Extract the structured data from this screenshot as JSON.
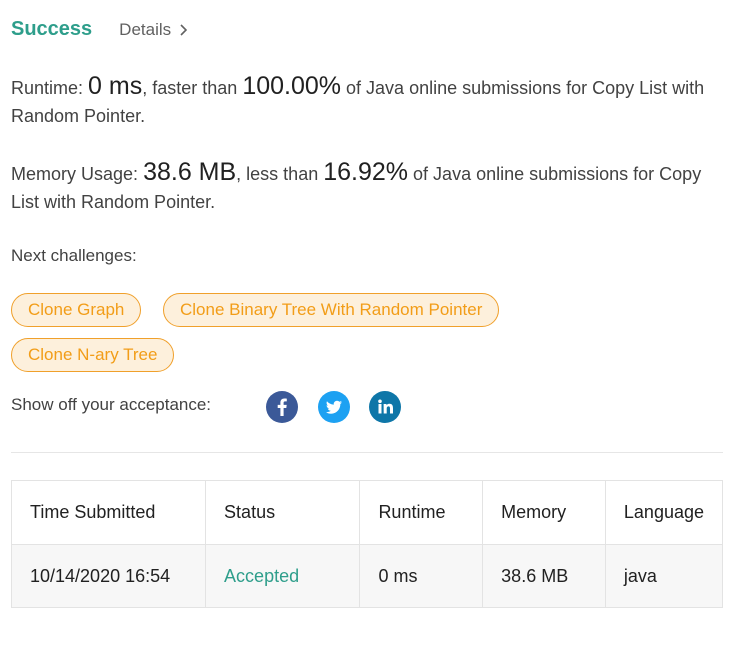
{
  "header": {
    "status": "Success",
    "details_label": "Details"
  },
  "runtime": {
    "label": "Runtime:",
    "value": "0 ms",
    "mid": ", faster than",
    "percent": "100.00%",
    "suffix": "of Java online submissions for Copy List with Random Pointer."
  },
  "memory": {
    "label": "Memory Usage:",
    "value": "38.6 MB",
    "mid": ", less than",
    "percent": "16.92%",
    "suffix": "of Java online submissions for Copy List with Random Pointer."
  },
  "next_challenges": {
    "label": "Next challenges:",
    "items": [
      "Clone Graph",
      "Clone Binary Tree With Random Pointer",
      "Clone N-ary Tree"
    ]
  },
  "share": {
    "label": "Show off your acceptance:",
    "icons": [
      "facebook-icon",
      "twitter-icon",
      "linkedin-icon"
    ],
    "colors": {
      "facebook": "#3b5998",
      "twitter": "#1da1f2",
      "linkedin": "#0e76a8"
    }
  },
  "table": {
    "headers": [
      "Time Submitted",
      "Status",
      "Runtime",
      "Memory",
      "Language"
    ],
    "rows": [
      [
        "10/14/2020 16:54",
        "Accepted",
        "0 ms",
        "38.6 MB",
        "java"
      ]
    ]
  },
  "colors": {
    "accent": "#2e9e8b",
    "chip_border": "#f0a02b",
    "chip_bg": "#fdf0dc",
    "chip_text": "#f29d18"
  }
}
